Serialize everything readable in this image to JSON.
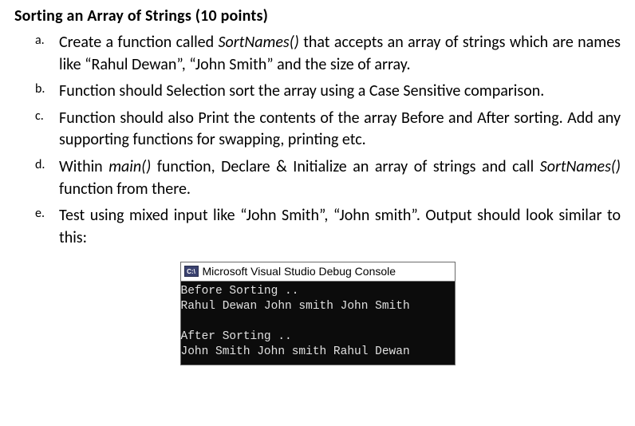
{
  "heading": "Sorting an Array of Strings (10 points)",
  "items": [
    {
      "marker": "a.",
      "segments": [
        {
          "text": "Create a function called "
        },
        {
          "text": "SortNames()",
          "italic": true
        },
        {
          "text": " that accepts an array of strings which are names like “Rahul Dewan”, “John Smith” and the size of array."
        }
      ]
    },
    {
      "marker": "b.",
      "segments": [
        {
          "text": "Function should Selection sort the array using a Case Sensitive comparison."
        }
      ]
    },
    {
      "marker": "c.",
      "segments": [
        {
          "text": "Function should also Print the contents of the array Before and After sorting.  Add any supporting functions for swapping, printing etc."
        }
      ]
    },
    {
      "marker": "d.",
      "segments": [
        {
          "text": "Within "
        },
        {
          "text": "main()",
          "italic": true
        },
        {
          "text": " function, Declare & Initialize an array of strings and call "
        },
        {
          "text": "SortNames()",
          "italic": true
        },
        {
          "text": " function from there."
        }
      ]
    },
    {
      "marker": "e.",
      "segments": [
        {
          "text": "Test using mixed input like “John Smith”, “John smith”.  Output should look similar to this:"
        }
      ]
    }
  ],
  "console": {
    "icon_label": "C:\\",
    "title": "Microsoft Visual Studio Debug Console",
    "lines": [
      "Before Sorting ..",
      "Rahul Dewan John smith John Smith",
      "",
      "After Sorting ..",
      "John Smith John smith Rahul Dewan"
    ]
  }
}
